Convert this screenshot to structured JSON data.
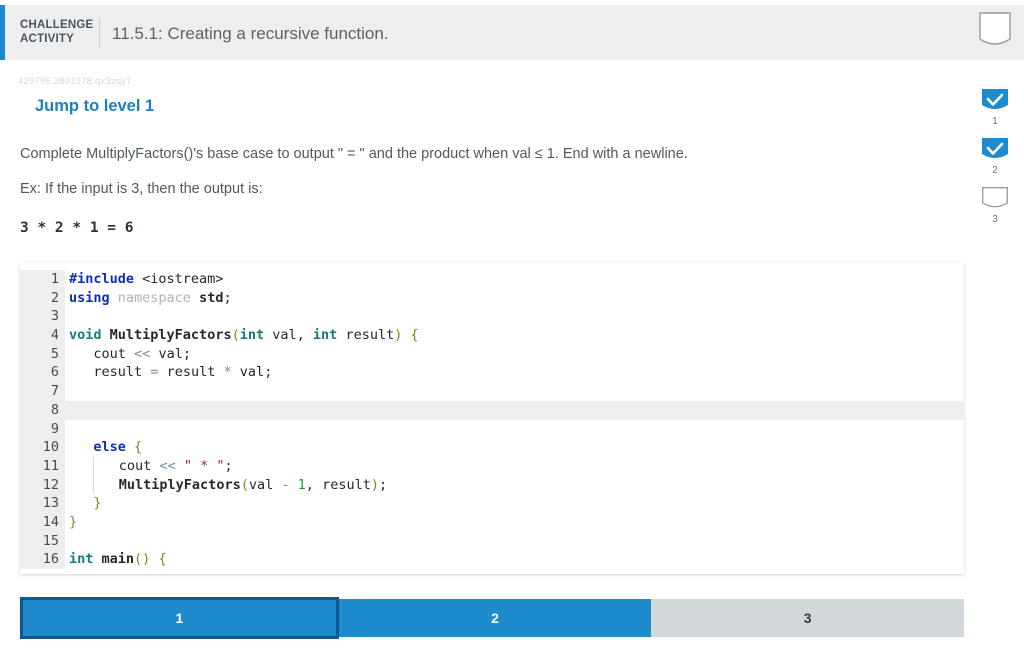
{
  "header": {
    "kicker_line1": "CHALLENGE",
    "kicker_line2": "ACTIVITY",
    "title": "11.5.1: Creating a recursive function.",
    "accent_color": "#1b8ad4",
    "bookmark_icon": "bookmark-outline-icon"
  },
  "content": {
    "activity_id": "429796.2801978.qx3zqy7",
    "jump_link": "Jump to level 1",
    "prompt": "Complete MultiplyFactors()'s base case to output \" = \" and the product when val ≤ 1. End with a newline.",
    "example_intro": "Ex: If the input is 3, then the output is:",
    "example_output": "3 * 2 * 1 = 6"
  },
  "progress_rail": [
    {
      "number": "1",
      "state": "complete",
      "icon": "check-bookmark-icon"
    },
    {
      "number": "2",
      "state": "complete",
      "icon": "check-bookmark-icon"
    },
    {
      "number": "3",
      "state": "empty",
      "icon": "empty-bookmark-icon"
    }
  ],
  "editor": {
    "highlighted_line": 8,
    "lines": [
      {
        "n": "1",
        "text": "#include <iostream>"
      },
      {
        "n": "2",
        "text": "using namespace std;"
      },
      {
        "n": "3",
        "text": ""
      },
      {
        "n": "4",
        "text": "void MultiplyFactors(int val, int result) {"
      },
      {
        "n": "5",
        "text": "   cout << val;"
      },
      {
        "n": "6",
        "text": "   result = result * val;"
      },
      {
        "n": "7",
        "text": ""
      },
      {
        "n": "8",
        "text": ""
      },
      {
        "n": "9",
        "text": ""
      },
      {
        "n": "10",
        "text": "   else {"
      },
      {
        "n": "11",
        "text": "      cout << \" * \";"
      },
      {
        "n": "12",
        "text": "      MultiplyFactors(val - 1, result);"
      },
      {
        "n": "13",
        "text": "   }"
      },
      {
        "n": "14",
        "text": "}"
      },
      {
        "n": "15",
        "text": ""
      },
      {
        "n": "16",
        "text": "int main() {"
      }
    ]
  },
  "tabs": [
    {
      "label": "1",
      "state": "active"
    },
    {
      "label": "2",
      "state": "done"
    },
    {
      "label": "3",
      "state": "todo"
    }
  ],
  "colors": {
    "brand_blue": "#1e8bcd",
    "active_border": "#14568f",
    "link_blue": "#1f7fc4",
    "tab_inactive": "#d2d7da",
    "header_bg": "#eeeeee"
  }
}
